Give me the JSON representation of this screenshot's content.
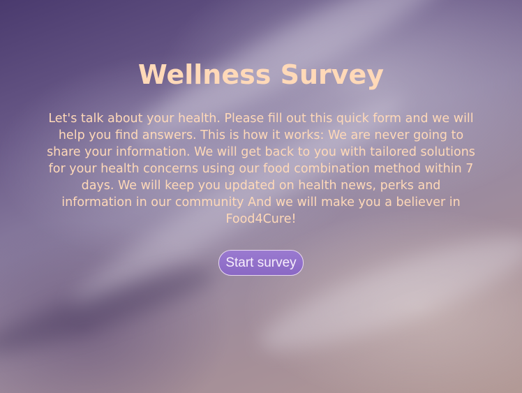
{
  "page": {
    "title": "Wellness Survey",
    "intro": "Let's talk about your health. Please fill out this quick form and we will help you find answers. This is how it works: We are never going to share your information. We will get back to you with tailored solutions for your health concerns using our food combination method within 7 days. We will keep you updated on health news, perks and information in our community And we will make you a believer in Food4Cure!",
    "start_button_label": "Start survey"
  },
  "colors": {
    "text_accent": "#ffd9b8",
    "button_fill": "#8a68c4",
    "button_text": "#f7eefc",
    "background_top": "#4a3a6e",
    "background_bottom": "#b39a96"
  }
}
